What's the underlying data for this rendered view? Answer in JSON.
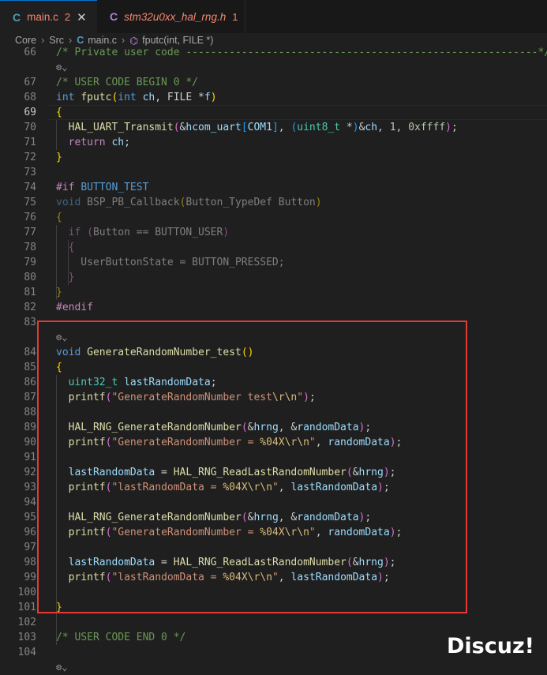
{
  "tabs": [
    {
      "label": "main.c",
      "badge": "2",
      "close": "✕",
      "icon": "C"
    },
    {
      "label": "stm32u0xx_hal_rng.h",
      "badge": "1",
      "icon": "C"
    }
  ],
  "breadcrumb": {
    "items": [
      "Core",
      "Src",
      "main.c",
      "fputc(int, FILE *)"
    ],
    "sep": "›",
    "file_icon": "C",
    "symbol_icon": "⌬"
  },
  "codelens_glyph": "⚙⌄",
  "watermark": "Discuz!",
  "lines": [
    {
      "n": "66",
      "t": [
        [
          "t-cmt",
          "/* Private user code ---------------------------------------------------------*/"
        ]
      ]
    },
    {
      "n": "",
      "t": [
        [
          "codelens",
          "⚙⌄"
        ]
      ]
    },
    {
      "n": "67",
      "t": [
        [
          "t-cmt",
          "/* USER CODE BEGIN 0 */"
        ]
      ]
    },
    {
      "n": "68",
      "t": [
        [
          "t-kw",
          "int"
        ],
        [
          "t-pl",
          " "
        ],
        [
          "t-fn",
          "fputc"
        ],
        [
          "t-p1",
          "("
        ],
        [
          "t-kw",
          "int"
        ],
        [
          "t-pl",
          " "
        ],
        [
          "t-var",
          "ch"
        ],
        [
          "t-pl",
          ", FILE "
        ],
        [
          "t-pl",
          "*"
        ],
        [
          "t-var",
          "f"
        ],
        [
          "t-p1",
          ")"
        ]
      ]
    },
    {
      "n": "69",
      "t": [
        [
          "t-p1",
          "{"
        ]
      ]
    },
    {
      "n": "70",
      "t": [
        [
          "t-pl",
          "  "
        ],
        [
          "t-fn",
          "HAL_UART_Transmit"
        ],
        [
          "t-p2",
          "("
        ],
        [
          "t-pl",
          "&"
        ],
        [
          "t-var",
          "hcom_uart"
        ],
        [
          "t-p3",
          "["
        ],
        [
          "t-var",
          "COM1"
        ],
        [
          "t-p3",
          "]"
        ],
        [
          "t-pl",
          ", "
        ],
        [
          "t-p3",
          "("
        ],
        [
          "t-ty",
          "uint8_t"
        ],
        [
          "t-pl",
          " *"
        ],
        [
          "t-p3",
          ")"
        ],
        [
          "t-pl",
          "&"
        ],
        [
          "t-var",
          "ch"
        ],
        [
          "t-pl",
          ", "
        ],
        [
          "t-num",
          "1"
        ],
        [
          "t-pl",
          ", "
        ],
        [
          "t-num",
          "0xffff"
        ],
        [
          "t-p2",
          ")"
        ],
        [
          "t-pl",
          ";"
        ]
      ]
    },
    {
      "n": "71",
      "t": [
        [
          "t-pl",
          "  "
        ],
        [
          "t-ctl",
          "return"
        ],
        [
          "t-pl",
          " "
        ],
        [
          "t-var",
          "ch"
        ],
        [
          "t-pl",
          ";"
        ]
      ]
    },
    {
      "n": "72",
      "t": [
        [
          "t-p1",
          "}"
        ]
      ]
    },
    {
      "n": "73",
      "t": []
    },
    {
      "n": "74",
      "t": [
        [
          "t-ctl",
          "#if"
        ],
        [
          "t-pl",
          " "
        ],
        [
          "t-mac",
          "BUTTON_TEST"
        ]
      ]
    },
    {
      "n": "75",
      "t": [
        [
          "t-kw dim",
          "void"
        ],
        [
          "t-pl dim",
          " BSP_PB_Callback"
        ],
        [
          "t-p1 dim",
          "("
        ],
        [
          "t-pl dim",
          "Button_TypeDef Button"
        ],
        [
          "t-p1 dim",
          ")"
        ]
      ]
    },
    {
      "n": "76",
      "t": [
        [
          "t-p1 dim",
          "{"
        ]
      ]
    },
    {
      "n": "77",
      "t": [
        [
          "t-pl",
          "  "
        ],
        [
          "t-ctl dim",
          "if"
        ],
        [
          "t-pl dim",
          " "
        ],
        [
          "t-p2 dim",
          "("
        ],
        [
          "t-pl dim",
          "Button == BUTTON_USER"
        ],
        [
          "t-p2 dim",
          ")"
        ]
      ]
    },
    {
      "n": "78",
      "t": [
        [
          "t-pl",
          "  "
        ],
        [
          "t-p2 dim",
          "{"
        ]
      ]
    },
    {
      "n": "79",
      "t": [
        [
          "t-pl dim",
          "    UserButtonState = BUTTON_PRESSED;"
        ]
      ]
    },
    {
      "n": "80",
      "t": [
        [
          "t-pl",
          "  "
        ],
        [
          "t-p2 dim",
          "}"
        ]
      ]
    },
    {
      "n": "81",
      "t": [
        [
          "t-p1 dim",
          "}"
        ]
      ]
    },
    {
      "n": "82",
      "t": [
        [
          "t-ctl",
          "#endif"
        ]
      ]
    },
    {
      "n": "83",
      "t": []
    },
    {
      "n": "",
      "t": [
        [
          "codelens",
          "⚙⌄"
        ]
      ]
    },
    {
      "n": "84",
      "t": [
        [
          "t-kw",
          "void"
        ],
        [
          "t-pl",
          " "
        ],
        [
          "t-fn",
          "GenerateRandomNumber_test"
        ],
        [
          "t-p1",
          "()"
        ]
      ]
    },
    {
      "n": "85",
      "t": [
        [
          "t-p1",
          "{"
        ]
      ]
    },
    {
      "n": "86",
      "t": [
        [
          "t-pl",
          "  "
        ],
        [
          "t-ty",
          "uint32_t"
        ],
        [
          "t-pl",
          " "
        ],
        [
          "t-var",
          "lastRandomData"
        ],
        [
          "t-pl",
          ";"
        ]
      ]
    },
    {
      "n": "87",
      "t": [
        [
          "t-pl",
          "  "
        ],
        [
          "t-fn",
          "printf"
        ],
        [
          "t-p2",
          "("
        ],
        [
          "t-str",
          "\"GenerateRandomNumber test"
        ],
        [
          "t-esc",
          "\\r\\n"
        ],
        [
          "t-str",
          "\""
        ],
        [
          "t-p2",
          ")"
        ],
        [
          "t-pl",
          ";"
        ]
      ]
    },
    {
      "n": "88",
      "t": []
    },
    {
      "n": "89",
      "t": [
        [
          "t-pl",
          "  "
        ],
        [
          "t-fn",
          "HAL_RNG_GenerateRandomNumber"
        ],
        [
          "t-p2",
          "("
        ],
        [
          "t-pl",
          "&"
        ],
        [
          "t-var",
          "hrng"
        ],
        [
          "t-pl",
          ", &"
        ],
        [
          "t-var",
          "randomData"
        ],
        [
          "t-p2",
          ")"
        ],
        [
          "t-pl",
          ";"
        ]
      ]
    },
    {
      "n": "90",
      "t": [
        [
          "t-pl",
          "  "
        ],
        [
          "t-fn",
          "printf"
        ],
        [
          "t-p2",
          "("
        ],
        [
          "t-str",
          "\"GenerateRandomNumber = "
        ],
        [
          "t-esc",
          "%04X"
        ],
        [
          "t-esc",
          "\\r\\n"
        ],
        [
          "t-str",
          "\""
        ],
        [
          "t-pl",
          ", "
        ],
        [
          "t-var",
          "randomData"
        ],
        [
          "t-p2",
          ")"
        ],
        [
          "t-pl",
          ";"
        ]
      ]
    },
    {
      "n": "91",
      "t": []
    },
    {
      "n": "92",
      "t": [
        [
          "t-pl",
          "  "
        ],
        [
          "t-var",
          "lastRandomData"
        ],
        [
          "t-pl",
          " = "
        ],
        [
          "t-fn",
          "HAL_RNG_ReadLastRandomNumber"
        ],
        [
          "t-p2",
          "("
        ],
        [
          "t-pl",
          "&"
        ],
        [
          "t-var",
          "hrng"
        ],
        [
          "t-p2",
          ")"
        ],
        [
          "t-pl",
          ";"
        ]
      ]
    },
    {
      "n": "93",
      "t": [
        [
          "t-pl",
          "  "
        ],
        [
          "t-fn",
          "printf"
        ],
        [
          "t-p2",
          "("
        ],
        [
          "t-str",
          "\"lastRandomData = "
        ],
        [
          "t-esc",
          "%04X"
        ],
        [
          "t-esc",
          "\\r\\n"
        ],
        [
          "t-str",
          "\""
        ],
        [
          "t-pl",
          ", "
        ],
        [
          "t-var",
          "lastRandomData"
        ],
        [
          "t-p2",
          ")"
        ],
        [
          "t-pl",
          ";"
        ]
      ]
    },
    {
      "n": "94",
      "t": []
    },
    {
      "n": "95",
      "t": [
        [
          "t-pl",
          "  "
        ],
        [
          "t-fn",
          "HAL_RNG_GenerateRandomNumber"
        ],
        [
          "t-p2",
          "("
        ],
        [
          "t-pl",
          "&"
        ],
        [
          "t-var",
          "hrng"
        ],
        [
          "t-pl",
          ", &"
        ],
        [
          "t-var",
          "randomData"
        ],
        [
          "t-p2",
          ")"
        ],
        [
          "t-pl",
          ";"
        ]
      ]
    },
    {
      "n": "96",
      "t": [
        [
          "t-pl",
          "  "
        ],
        [
          "t-fn",
          "printf"
        ],
        [
          "t-p2",
          "("
        ],
        [
          "t-str",
          "\"GenerateRandomNumber = "
        ],
        [
          "t-esc",
          "%04X"
        ],
        [
          "t-esc",
          "\\r\\n"
        ],
        [
          "t-str",
          "\""
        ],
        [
          "t-pl",
          ", "
        ],
        [
          "t-var",
          "randomData"
        ],
        [
          "t-p2",
          ")"
        ],
        [
          "t-pl",
          ";"
        ]
      ]
    },
    {
      "n": "97",
      "t": []
    },
    {
      "n": "98",
      "t": [
        [
          "t-pl",
          "  "
        ],
        [
          "t-var",
          "lastRandomData"
        ],
        [
          "t-pl",
          " = "
        ],
        [
          "t-fn",
          "HAL_RNG_ReadLastRandomNumber"
        ],
        [
          "t-p2",
          "("
        ],
        [
          "t-pl",
          "&"
        ],
        [
          "t-var",
          "hrng"
        ],
        [
          "t-p2",
          ")"
        ],
        [
          "t-pl",
          ";"
        ]
      ]
    },
    {
      "n": "99",
      "t": [
        [
          "t-pl",
          "  "
        ],
        [
          "t-fn",
          "printf"
        ],
        [
          "t-p2",
          "("
        ],
        [
          "t-str",
          "\"lastRandomData = "
        ],
        [
          "t-esc",
          "%04X"
        ],
        [
          "t-esc",
          "\\r\\n"
        ],
        [
          "t-str",
          "\""
        ],
        [
          "t-pl",
          ", "
        ],
        [
          "t-var",
          "lastRandomData"
        ],
        [
          "t-p2",
          ")"
        ],
        [
          "t-pl",
          ";"
        ]
      ]
    },
    {
      "n": "100",
      "t": []
    },
    {
      "n": "101",
      "t": [
        [
          "t-p1",
          "}"
        ]
      ]
    },
    {
      "n": "102",
      "t": []
    },
    {
      "n": "103",
      "t": [
        [
          "t-cmt",
          "/* USER CODE END 0 */"
        ]
      ]
    },
    {
      "n": "104",
      "t": []
    },
    {
      "n": "",
      "t": [
        [
          "codelens",
          "⚙⌄"
        ]
      ]
    }
  ],
  "current_line": "69"
}
